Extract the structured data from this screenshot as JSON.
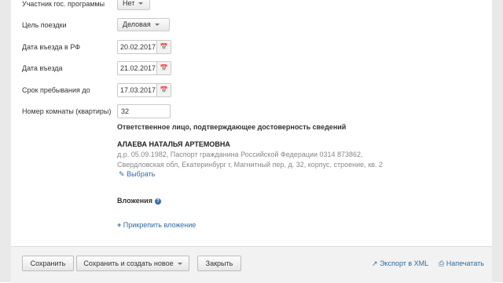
{
  "form": {
    "gov_program": {
      "label": "Участник гос. программы",
      "value": "Нет"
    },
    "trip_purpose": {
      "label": "Цель поездки",
      "value": "Деловая"
    },
    "entry_date_rf": {
      "label": "Дата въезда в РФ",
      "value": "20.02.2017"
    },
    "entry_date": {
      "label": "Дата въезда",
      "value": "21.02.2017"
    },
    "stay_until": {
      "label": "Срок пребывания до",
      "value": "17.03.2017"
    },
    "room_number": {
      "label": "Номер комнаты (квартиры)",
      "value": "32"
    }
  },
  "responsible": {
    "title": "Ответственное лицо, подтверждающее достоверность сведений",
    "name": "АЛАЕВА НАТАЛЬЯ АРТЕМОВНА",
    "details_line1": "д.р. 05.09.1982, Паспорт гражданина Российской Федерации 0314 873862,",
    "details_line2": "Свердловская обл, Екатеринбург г, Магнитный пер, д. 32, корпус, строение, кв. 2",
    "select_link": "Выбрать"
  },
  "attachments": {
    "title": "Вложения",
    "help_icon": "?",
    "attach_link": "Прикрепить вложение"
  },
  "footer": {
    "save": "Сохранить",
    "save_and_new": "Сохранить и создать новое",
    "close": "Закрыть",
    "export_xml": "Экспорт в XML",
    "print": "Напечатать"
  },
  "icons": {
    "calendar": "calendar-icon",
    "pencil": "pencil-icon",
    "plus": "plus-icon",
    "export": "export-icon",
    "print": "print-icon"
  },
  "colors": {
    "link": "#2e6ca4",
    "help_icon": "#3a6fb0",
    "side_frame": "#e9e9e9",
    "footer_bg": "#f2f2f2"
  }
}
